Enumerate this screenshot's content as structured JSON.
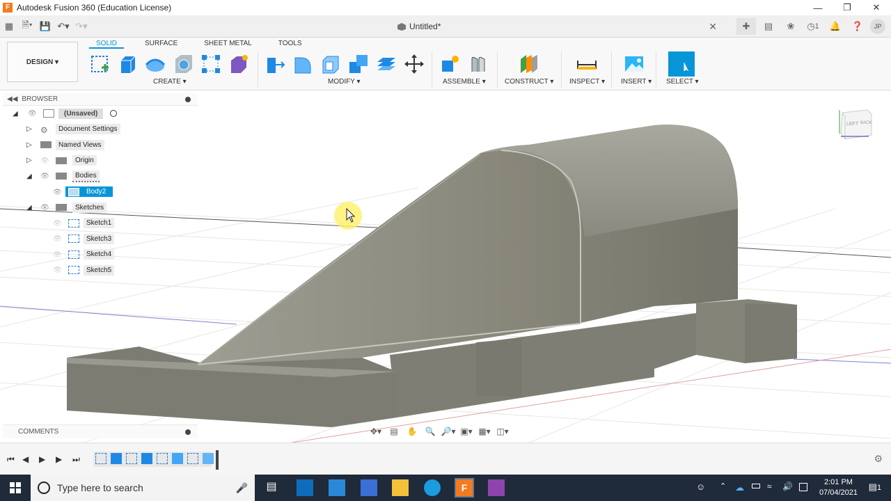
{
  "window": {
    "title": "Autodesk Fusion 360 (Education License)",
    "logo_letter": "F"
  },
  "document": {
    "tab_name": "Untitled*"
  },
  "header": {
    "jobs_count": "1",
    "user_initials": "JP"
  },
  "workspace": {
    "label": "DESIGN"
  },
  "tabs": [
    {
      "label": "SOLID",
      "active": true
    },
    {
      "label": "SURFACE",
      "active": false
    },
    {
      "label": "SHEET METAL",
      "active": false
    },
    {
      "label": "TOOLS",
      "active": false
    }
  ],
  "groups": {
    "create": "CREATE",
    "modify": "MODIFY",
    "assemble": "ASSEMBLE",
    "construct": "CONSTRUCT",
    "inspect": "INSPECT",
    "insert": "INSERT",
    "select": "SELECT"
  },
  "browser": {
    "title": "BROWSER",
    "root": "(Unsaved)",
    "items": [
      {
        "label": "Document Settings"
      },
      {
        "label": "Named Views"
      },
      {
        "label": "Origin"
      },
      {
        "label": "Bodies"
      },
      {
        "label": "Body2"
      },
      {
        "label": "Sketches"
      },
      {
        "label": "Sketch1"
      },
      {
        "label": "Sketch3"
      },
      {
        "label": "Sketch4"
      },
      {
        "label": "Sketch5"
      }
    ]
  },
  "comments": {
    "title": "COMMENTS"
  },
  "viewcube": {
    "left": "LEFT",
    "front": "BACK"
  },
  "taskbar": {
    "search_placeholder": "Type here to search",
    "time": "2:01 PM",
    "date": "07/04/2021",
    "notification_count": "1"
  }
}
